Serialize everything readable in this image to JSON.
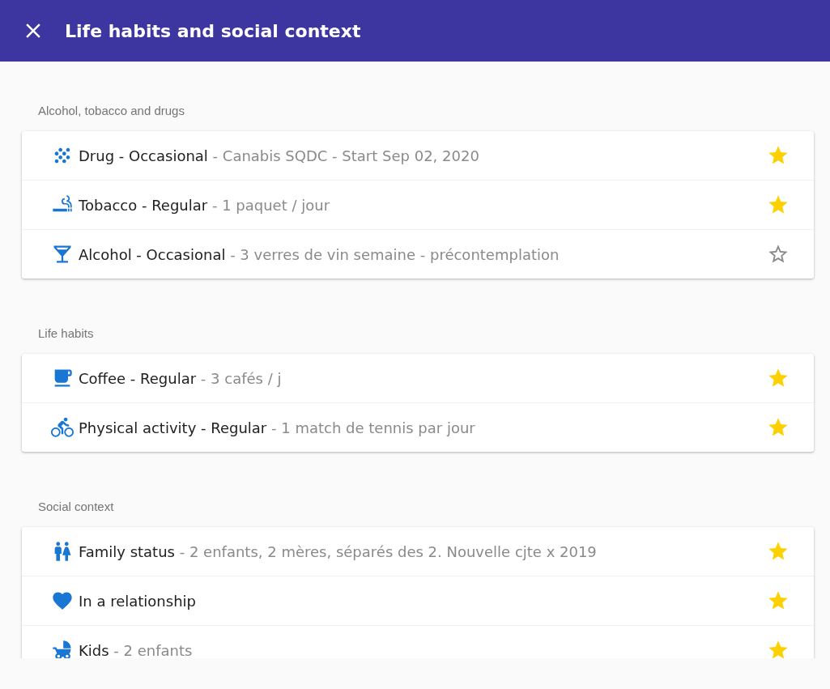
{
  "header": {
    "title": "Life habits and social context"
  },
  "sections": [
    {
      "title": "Alcohol, tobacco and drugs",
      "items": [
        {
          "kind": "drug",
          "title": "Drug - Occasional",
          "detail": "- Canabis SQDC - Start Sep 02, 2020",
          "starred": true
        },
        {
          "kind": "tobacco",
          "title": "Tobacco - Regular",
          "detail": "- 1 paquet / jour",
          "starred": true
        },
        {
          "kind": "alcohol",
          "title": "Alcohol - Occasional",
          "detail": "- 3 verres de vin semaine - précontemplation",
          "starred": false
        }
      ]
    },
    {
      "title": "Life habits",
      "items": [
        {
          "kind": "coffee",
          "title": "Coffee - Regular",
          "detail": "- 3 cafés / j",
          "starred": true
        },
        {
          "kind": "bike",
          "title": "Physical activity - Regular",
          "detail": "- 1 match de tennis par jour",
          "starred": true
        }
      ]
    },
    {
      "title": "Social context",
      "items": [
        {
          "kind": "family",
          "title": "Family status",
          "detail": "- 2 enfants, 2 mères, séparés des 2. Nouvelle cjte x 2019",
          "starred": true
        },
        {
          "kind": "relationship",
          "title": "In a relationship",
          "starred": true
        },
        {
          "kind": "kids",
          "title": "Kids",
          "detail": "- 2 enfants",
          "starred": true
        }
      ]
    }
  ]
}
